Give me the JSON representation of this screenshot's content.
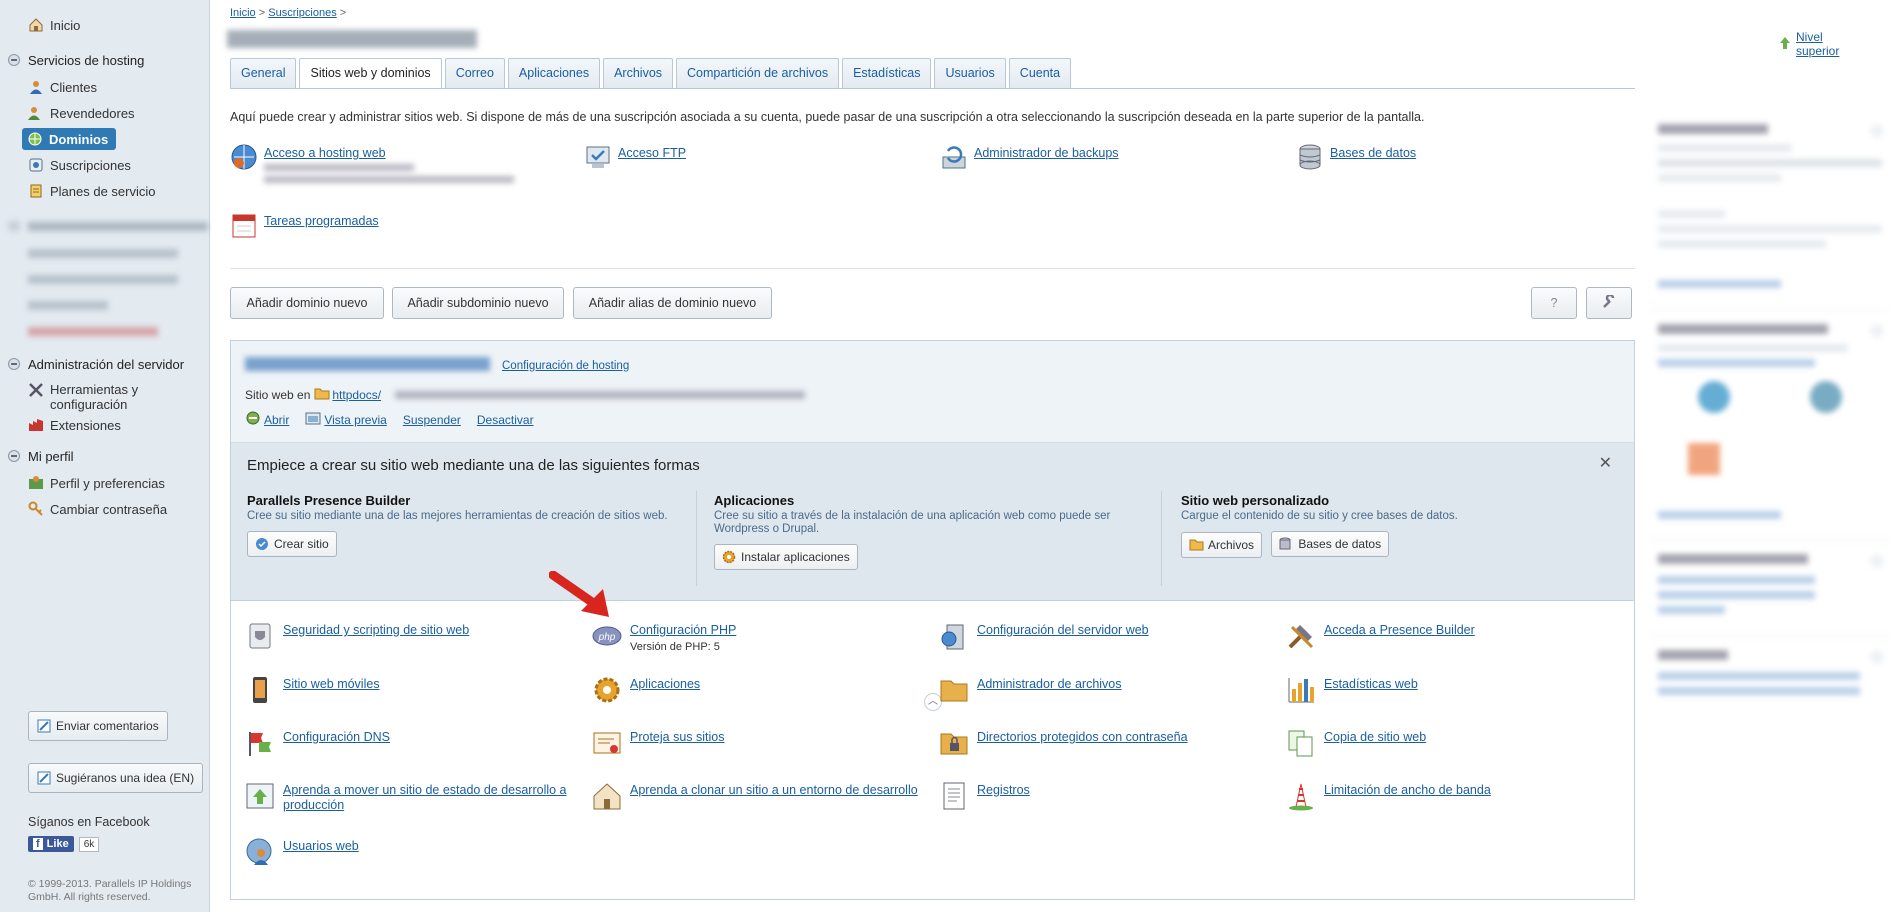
{
  "sidebar": {
    "home": "Inicio",
    "hosting_group": "Servicios de hosting",
    "hosting_items": [
      "Clientes",
      "Revendedores",
      "Dominios",
      "Suscripciones",
      "Planes de servicio"
    ],
    "server_group": "Administración del servidor",
    "server_items": [
      "Herramientas y configuración",
      "Extensiones"
    ],
    "profile_group": "Mi perfil",
    "profile_items": [
      "Perfil y preferencias",
      "Cambiar contraseña"
    ],
    "feedback_button": "Enviar comentarios",
    "idea_button": "Sugiéranos una idea (EN)",
    "facebook_label": "Síganos en Facebook",
    "like_label": "Like",
    "like_count": "6k",
    "copyright": "© 1999-2013. Parallels IP Holdings GmbH. All rights reserved."
  },
  "header": {
    "breadcrumb": [
      "Inicio",
      "Suscripciones"
    ],
    "upper_level": "Nivel superior"
  },
  "tabs": [
    "General",
    "Sitios web y dominios",
    "Correo",
    "Aplicaciones",
    "Archivos",
    "Compartición de archivos",
    "Estadísticas",
    "Usuarios",
    "Cuenta"
  ],
  "intro": "Aquí puede crear y administrar sitios web. Si dispone de más de una suscripción asociada a su cuenta, puede pasar de una suscripción a otra seleccionando la suscripción deseada en la parte superior de la pantalla.",
  "tools": [
    "Acceso a hosting web",
    "Acceso FTP",
    "Administrador de backups",
    "Bases de datos",
    "Tareas programadas"
  ],
  "buttons": {
    "add_domain": "Añadir dominio nuevo",
    "add_subdomain": "Añadir subdominio nuevo",
    "add_alias": "Añadir alias de dominio nuevo",
    "help": "?"
  },
  "domain": {
    "hosting_config": "Configuración de hosting",
    "site_at": "Sitio web en",
    "docroot": "httpdocs/",
    "actions": [
      "Abrir",
      "Vista previa",
      "Suspender",
      "Desactivar"
    ]
  },
  "quickstart": {
    "title": "Empiece a crear su sitio web mediante una de las siguientes formas",
    "cols": [
      {
        "title": "Parallels Presence Builder",
        "desc": "Cree su sitio mediante una de las mejores herramientas de creación de sitios web.",
        "buttons": [
          "Crear sitio"
        ]
      },
      {
        "title": "Aplicaciones",
        "desc": "Cree su sitio a través de la instalación de una aplicación web como puede ser Wordpress o Drupal.",
        "buttons": [
          "Instalar aplicaciones"
        ]
      },
      {
        "title": "Sitio web personalizado",
        "desc": "Cargue el contenido de su sitio y cree bases de datos.",
        "buttons": [
          "Archivos",
          "Bases de datos"
        ]
      }
    ]
  },
  "features": {
    "security": "Seguridad y scripting de sitio web",
    "php": "Configuración PHP",
    "php_version": "Versión de PHP: 5",
    "webserver": "Configuración del servidor web",
    "presence": "Acceda a Presence Builder",
    "mobile": "Sitio web móviles",
    "apps": "Aplicaciones",
    "filemanager": "Administrador de archivos",
    "webstats": "Estadísticas web",
    "dns": "Configuración DNS",
    "protect": "Proteja sus sitios",
    "protected_dirs": "Directorios protegidos con contraseña",
    "copy_site": "Copia de sitio web",
    "move_site": "Aprenda a mover un sitio de estado de desarrollo a producción",
    "clone_site": "Aprenda a clonar un sitio a un entorno de desarrollo",
    "logs": "Registros",
    "bandwidth": "Limitación de ancho de banda",
    "webusers": "Usuarios web"
  },
  "colors": {
    "link": "#1a5fa0",
    "active_nav": "#2f79b5",
    "panel_bg": "#dfe7ee"
  }
}
